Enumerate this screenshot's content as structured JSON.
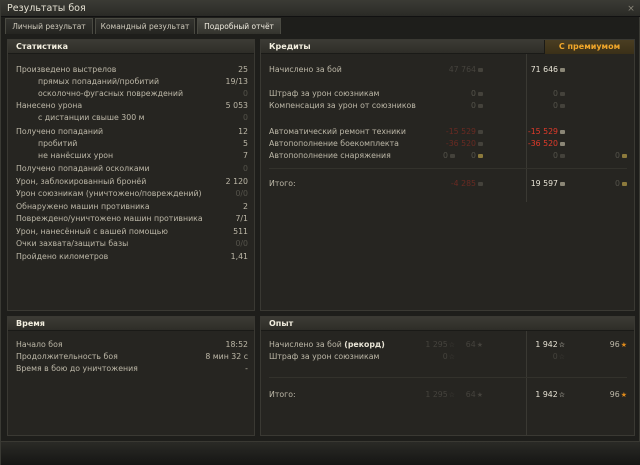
{
  "window": {
    "title": "Результаты боя",
    "close_glyph": "×"
  },
  "tabs": [
    {
      "label": "Личный результат"
    },
    {
      "label": "Командный результат"
    },
    {
      "label": "Подробный отчёт"
    }
  ],
  "stats": {
    "header": "Статистика",
    "rows": [
      {
        "label": "Произведено выстрелов",
        "value": "25"
      },
      {
        "label": "прямых попаданий/пробитий",
        "value": "19/13"
      },
      {
        "label": "осколочно-фугасных повреждений",
        "value": "0"
      },
      {
        "label": "Нанесено урона",
        "value": "5 053"
      },
      {
        "label": "с дистанции свыше 300 м",
        "value": "0"
      },
      {
        "label": "Получено попаданий",
        "value": "12"
      },
      {
        "label": "пробитий",
        "value": "5"
      },
      {
        "label": "не нанёсших урон",
        "value": "7"
      },
      {
        "label": "Получено попаданий осколками",
        "value": "0"
      },
      {
        "label": "Урон, заблокированный бронёй",
        "value": "2 120"
      },
      {
        "label": "Урон союзникам (уничтожено/повреждений)",
        "value": "0/0"
      },
      {
        "label": "Обнаружено машин противника",
        "value": "2"
      },
      {
        "label": "Повреждено/уничтожено машин противника",
        "value": "7/1"
      },
      {
        "label": "Урон, нанесённый с вашей помощью",
        "value": "511"
      },
      {
        "label": "Очки захвата/защиты базы",
        "value": "0/0"
      },
      {
        "label": "Пройдено километров",
        "value": "1,41"
      }
    ]
  },
  "credits": {
    "header": "Кредиты",
    "premium_header": "С премиумом",
    "rows": [
      {
        "label": "Начислено за бой",
        "base": "47 764",
        "prem": "71 646"
      },
      {
        "label": "Штраф за урон союзникам",
        "base": "0",
        "prem": "0"
      },
      {
        "label": "Компенсация за урон от союзников",
        "base": "0",
        "prem": "0"
      },
      {
        "label": "Автоматический ремонт техники",
        "base": "-15 529",
        "prem": "-15 529"
      },
      {
        "label": "Автопополнение боекомплекта",
        "base": "-36 520",
        "prem": "-36 520"
      },
      {
        "label": "Автопополнение снаряжения",
        "base": "0",
        "base_gold": "0",
        "prem": "0",
        "prem_gold": "0"
      },
      {
        "label": "Итого:",
        "base": "-4 285",
        "prem": "19 597",
        "prem_gold": "0"
      }
    ]
  },
  "time": {
    "header": "Время",
    "rows": [
      {
        "label": "Начало боя",
        "value": "18:52"
      },
      {
        "label": "Продолжительность боя",
        "value": "8 мин 32 с"
      },
      {
        "label": "Время в бою до уничтожения",
        "value": "-"
      }
    ]
  },
  "xp": {
    "header": "Опыт",
    "rows": [
      {
        "label": "Начислено за бой",
        "label_suffix": "(рекорд)",
        "base": "1 295",
        "base_free": "64",
        "prem": "1 942",
        "prem_free": "96"
      },
      {
        "label": "Штраф за урон союзникам",
        "base": "0",
        "prem": "0"
      },
      {
        "label": "Итого:",
        "base": "1 295",
        "base_free": "64",
        "prem": "1 942",
        "prem_free": "96"
      }
    ]
  },
  "colors": {
    "accent": "#f2a72a",
    "negative": "#e13a2a",
    "text": "#bdb8a8"
  }
}
